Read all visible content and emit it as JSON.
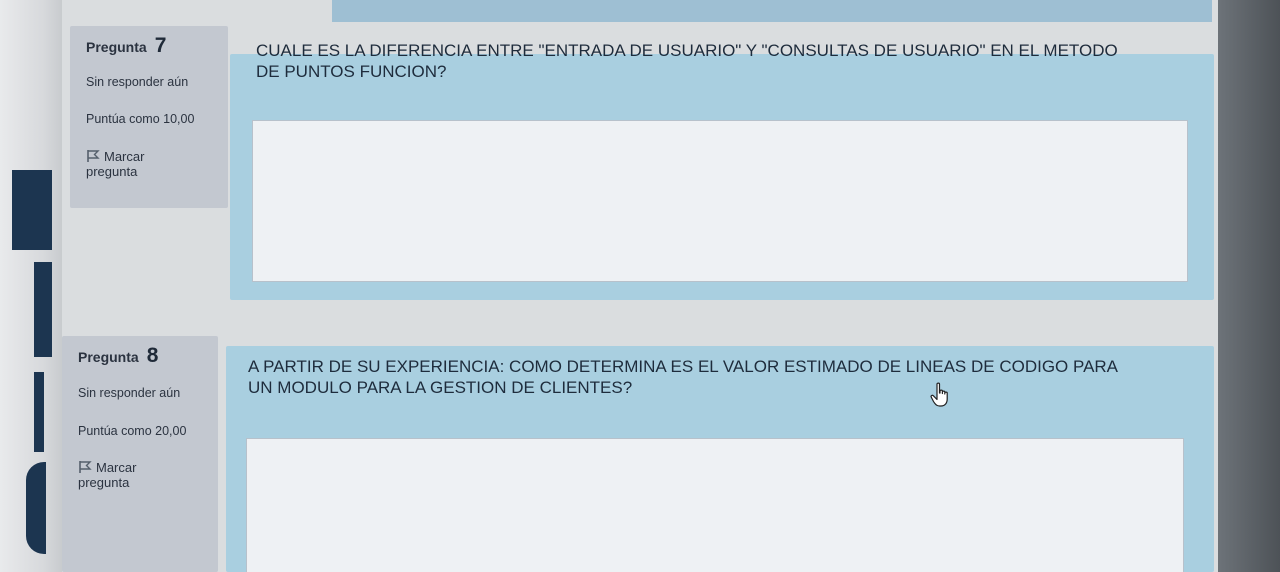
{
  "questions": [
    {
      "label": "Pregunta",
      "number": "7",
      "status": "Sin responder aún",
      "score": "Puntúa como 10,00",
      "flag_line1": "Marcar",
      "flag_line2": "pregunta",
      "text": "CUALE ES LA DIFERENCIA ENTRE \"ENTRADA DE USUARIO\" Y \"CONSULTAS DE USUARIO\" EN EL METODO DE PUNTOS FUNCION?",
      "answer": ""
    },
    {
      "label": "Pregunta",
      "number": "8",
      "status": "Sin responder aún",
      "score": "Puntúa como 20,00",
      "flag_line1": "Marcar",
      "flag_line2": "pregunta",
      "text": "A PARTIR DE SU EXPERIENCIA: COMO DETERMINA ES EL VALOR ESTIMADO DE LINEAS DE CODIGO PARA UN MODULO PARA LA GESTION DE CLIENTES?",
      "answer": ""
    }
  ],
  "icons": {
    "flag": "flag-icon",
    "cursor": "hand-pointer-icon"
  }
}
